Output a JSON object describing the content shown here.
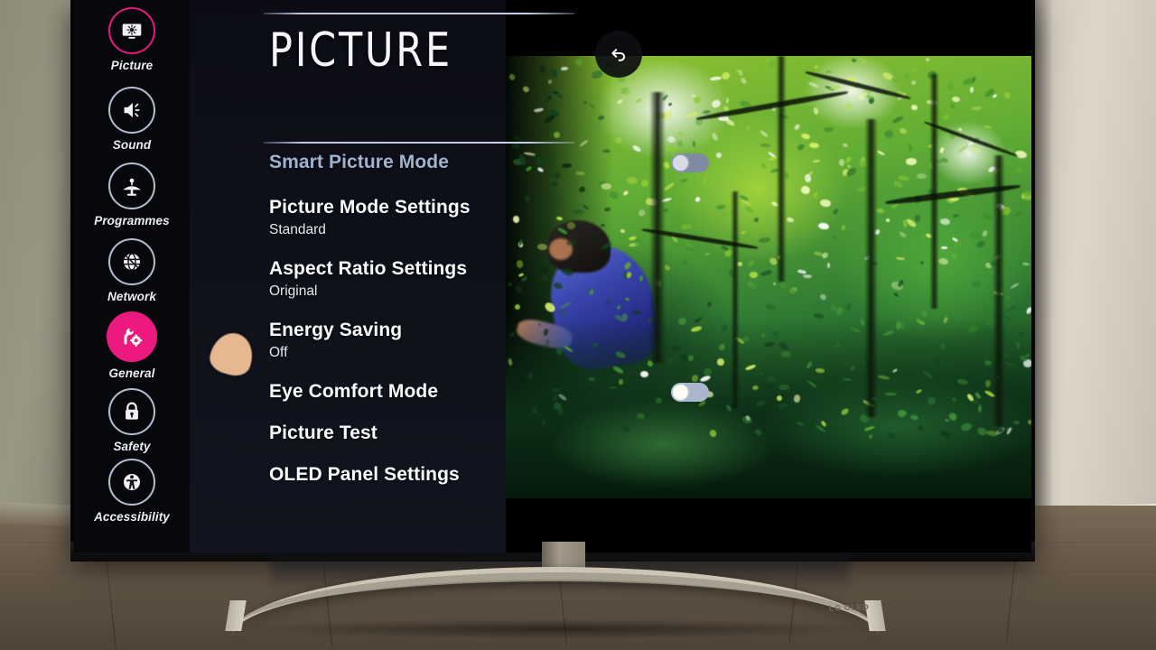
{
  "device": {
    "brand_logo": "LG OLED"
  },
  "menu": {
    "page_title": "PICTURE",
    "back_button_label": "Back",
    "sidebar": {
      "items": [
        {
          "label": "Picture",
          "icon": "tv-brightness-icon",
          "state": "selected-ring"
        },
        {
          "label": "Sound",
          "icon": "speaker-icon",
          "state": "normal"
        },
        {
          "label": "Programmes",
          "icon": "satellite-dish-icon",
          "state": "normal"
        },
        {
          "label": "Network",
          "icon": "globe-icon",
          "state": "normal"
        },
        {
          "label": "General",
          "icon": "wrench-gear-icon",
          "state": "focused-filled"
        },
        {
          "label": "Safety",
          "icon": "padlock-icon",
          "state": "normal"
        },
        {
          "label": "Accessibility",
          "icon": "accessibility-icon",
          "state": "normal"
        }
      ]
    },
    "rows": [
      {
        "title": "Smart Picture Mode",
        "value": "",
        "control": "toggle",
        "toggle_on": false,
        "muted": true
      },
      {
        "title": "Picture Mode Settings",
        "value": "Standard",
        "control": "none",
        "toggle_on": false,
        "muted": false
      },
      {
        "title": "Aspect Ratio Settings",
        "value": "Original",
        "control": "none",
        "toggle_on": false,
        "muted": false
      },
      {
        "title": "Energy Saving",
        "value": "Off",
        "control": "none",
        "toggle_on": false,
        "muted": false
      },
      {
        "title": "Eye Comfort Mode",
        "value": "",
        "control": "toggle",
        "toggle_on": false,
        "muted": false
      },
      {
        "title": "Picture Test",
        "value": "",
        "control": "none",
        "toggle_on": false,
        "muted": false
      },
      {
        "title": "OLED Panel Settings",
        "value": "",
        "control": "none",
        "toggle_on": false,
        "muted": false
      }
    ]
  },
  "colors": {
    "accent_pink": "#ec1a7e",
    "menu_bg": "#0e1019",
    "sidebar_bg": "#07080c",
    "text_primary": "#fbfcfe",
    "text_muted": "#9fb4cf",
    "divider": "#c3cfe4",
    "cursor": "#f7c59a"
  }
}
